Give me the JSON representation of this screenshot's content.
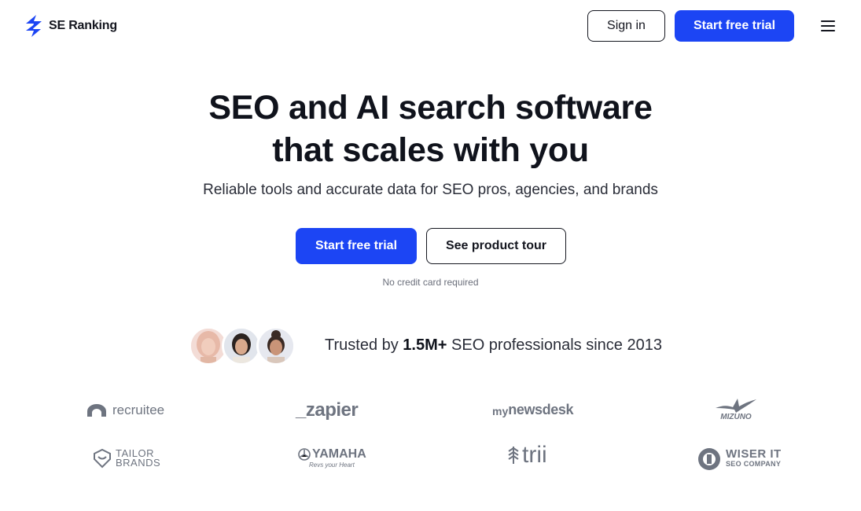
{
  "header": {
    "logo_text": "SE Ranking",
    "signin_label": "Sign in",
    "trial_label": "Start free trial"
  },
  "hero": {
    "title_line1": "SEO and AI search software",
    "title_line2": "that scales with you",
    "subtitle": "Reliable tools and accurate data for SEO pros, agencies, and brands",
    "cta_trial": "Start free trial",
    "cta_tour": "See product tour",
    "note": "No credit card required"
  },
  "trust": {
    "prefix": "Trusted by ",
    "highlight": "1.5M+",
    "suffix": " SEO professionals since 2013"
  },
  "brands": {
    "recruitee": "recruitee",
    "zapier": "_zapier",
    "mynewsdesk_my": "my",
    "mynewsdesk_rest": "newsdesk",
    "mizuno": "MIZUNO",
    "tailor_line1": "TAILOR",
    "tailor_line2": "BRANDS",
    "yamaha": "YAMAHA",
    "yamaha_tagline": "Revs your Heart",
    "trii": "trii",
    "wiser_line1": "WISER IT",
    "wiser_line2": "SEO COMPANY"
  },
  "colors": {
    "primary": "#1c45f4",
    "text": "#10131c",
    "logo_gray": "#6e7480"
  },
  "icons": [
    "se-ranking-logo-icon",
    "menu-icon",
    "avatar-1",
    "avatar-2",
    "avatar-3"
  ]
}
